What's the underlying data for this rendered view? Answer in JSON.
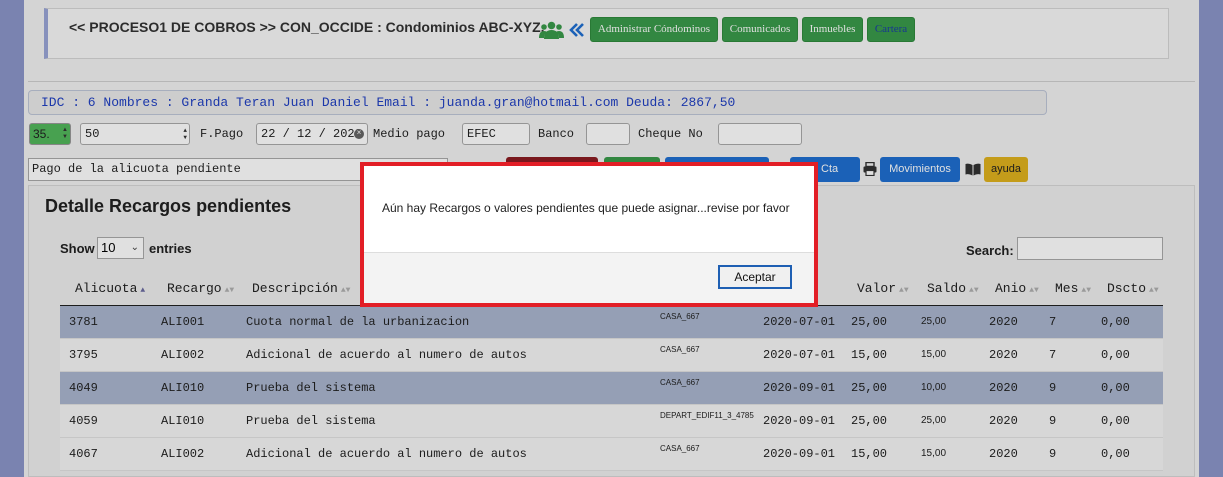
{
  "header": {
    "title": "<< PROCESO1 DE COBROS >> CON_OCCIDE : Condominios ABC-XYZ.",
    "nav": [
      {
        "label": "Administrar Cóndominos",
        "style": "green"
      },
      {
        "label": "Comunicados",
        "style": "green"
      },
      {
        "label": "Inmuebles",
        "style": "green"
      },
      {
        "label": "Cartera",
        "style": "blue"
      }
    ]
  },
  "info_bar": "IDC : 6 Nombres : Granda Teran Juan Daniel Email : juanda.gran@hotmail.com Deuda: 2867,50",
  "form": {
    "spinner_value": "35.",
    "amount_value": "50",
    "fpago_label": "F.Pago",
    "fpago_value": "22 / 12 / 2020",
    "medio_label": "Medio pago",
    "medio_value": "EFEC",
    "banco_label": "Banco",
    "banco_value": "",
    "cheque_label": "Cheque No",
    "cheque_value": "",
    "description_value": "Pago de la alicuota pendiente"
  },
  "actions": {
    "estado_label": "o Cta",
    "movimientos_label": "Movimientos",
    "ayuda_label": "ayuda"
  },
  "panel": {
    "title": "Detalle Recargos pendientes",
    "show_label": "Show",
    "entries_value": "10",
    "entries_label": "entries",
    "search_label": "Search:"
  },
  "table": {
    "columns": [
      "Alicuota",
      "Recargo",
      "Descripción",
      "",
      "",
      "Valor",
      "Saldo",
      "Anio",
      "Mes",
      "Dscto"
    ],
    "rows": [
      [
        "3781",
        "ALI001",
        "Cuota normal de la urbanizacion",
        "CASA_667",
        "2020-07-01",
        "25,00",
        "25,00",
        "2020",
        "7",
        "0,00"
      ],
      [
        "3795",
        "ALI002",
        "Adicional de acuerdo al numero de autos",
        "CASA_667",
        "2020-07-01",
        "15,00",
        "15,00",
        "2020",
        "7",
        "0,00"
      ],
      [
        "4049",
        "ALI010",
        "Prueba del sistema",
        "CASA_667",
        "2020-09-01",
        "25,00",
        "10,00",
        "2020",
        "9",
        "0,00"
      ],
      [
        "4059",
        "ALI010",
        "Prueba del sistema",
        "DEPART_EDIF11_3_4785",
        "2020-09-01",
        "25,00",
        "25,00",
        "2020",
        "9",
        "0,00"
      ],
      [
        "4067",
        "ALI002",
        "Adicional de acuerdo al numero de autos",
        "CASA_667",
        "2020-09-01",
        "15,00",
        "15,00",
        "2020",
        "9",
        "0,00"
      ]
    ]
  },
  "dialog": {
    "message": "Aún hay Recargos o valores pendientes que puede asignar...revise por favor",
    "ok_label": "Aceptar"
  },
  "colors": {
    "green": "#3a9a4a",
    "blue": "#1f6fd1",
    "ayuda": "#e0b21e",
    "row_highlight": "#aab6cf",
    "dialog_border": "#e21e26"
  }
}
